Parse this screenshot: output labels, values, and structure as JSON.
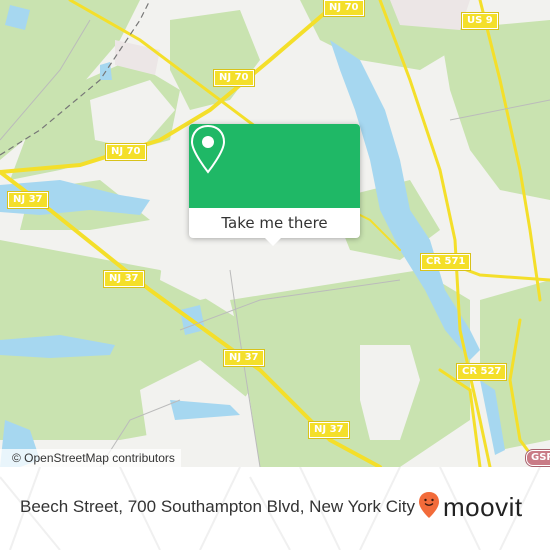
{
  "map": {
    "colors": {
      "land": "#f2f2ef",
      "forest": "#c9e3b0",
      "water": "#a6d7f0",
      "road": "#f4df2a",
      "urban": "#ece6e6"
    },
    "road_labels": [
      {
        "id": "nj70-top",
        "label": "NJ 70"
      },
      {
        "id": "nj70-mid",
        "label": "NJ 70"
      },
      {
        "id": "nj70-left",
        "label": "NJ 70"
      },
      {
        "id": "us9",
        "label": "US 9"
      },
      {
        "id": "nj37-left",
        "label": "NJ 37"
      },
      {
        "id": "nj37-a",
        "label": "NJ 37"
      },
      {
        "id": "nj37-b",
        "label": "NJ 37"
      },
      {
        "id": "nj37-c",
        "label": "NJ 37"
      },
      {
        "id": "cr571",
        "label": "CR 571"
      },
      {
        "id": "cr527",
        "label": "CR 527"
      },
      {
        "id": "gsp",
        "label": "GSP"
      }
    ],
    "attribution": "© OpenStreetMap contributors"
  },
  "popup": {
    "icon": "map-pin-icon",
    "accent": "#1fb866",
    "button_label": "Take me there"
  },
  "footer": {
    "address": "Beech Street, 700 Southampton Blvd, New York City",
    "brand": "moovit",
    "brand_color": "#f26b3a"
  }
}
